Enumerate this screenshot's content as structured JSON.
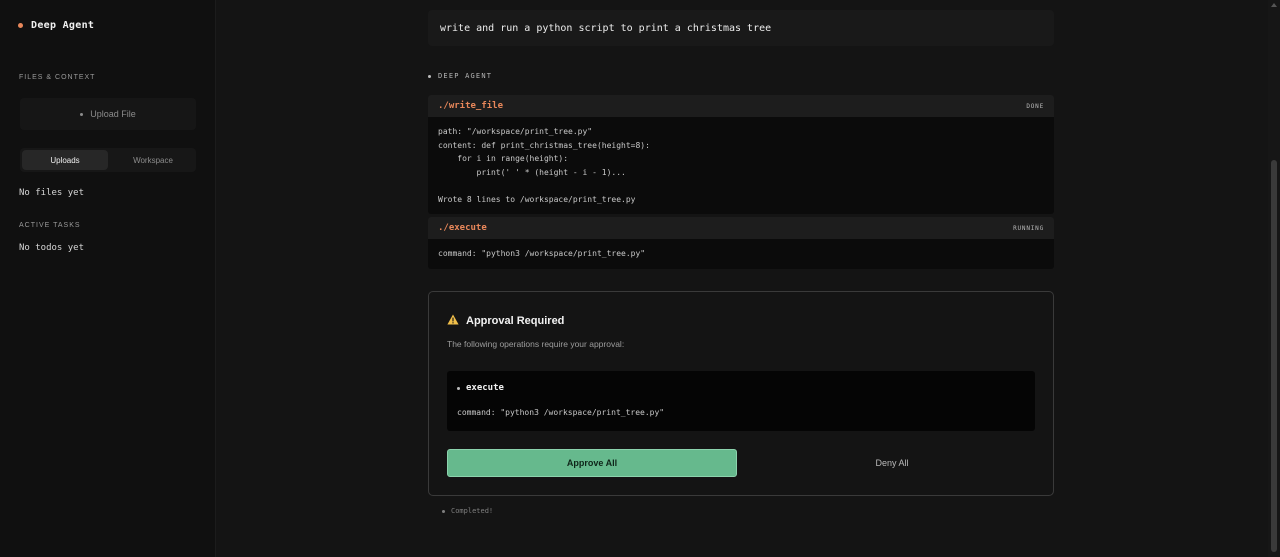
{
  "sidebar": {
    "brand": "Deep Agent",
    "files_label": "FILES & CONTEXT",
    "upload_label": "Upload File",
    "tabs": [
      {
        "label": "Uploads",
        "active": true
      },
      {
        "label": "Workspace",
        "active": false
      }
    ],
    "files_empty": "No files yet",
    "tasks_label": "ACTIVE TASKS",
    "tasks_empty": "No todos yet"
  },
  "chat": {
    "user_prompt": "write and run a python script to print a christmas tree",
    "agent_label": "DEEP AGENT",
    "tools": [
      {
        "name": "./write_file",
        "status": "DONE",
        "body": "path: \"/workspace/print_tree.py\"\ncontent: def print_christmas_tree(height=8):\n    for i in range(height):\n        print(' ' * (height - i - 1)...\n\nWrote 8 lines to /workspace/print_tree.py"
      },
      {
        "name": "./execute",
        "status": "RUNNING",
        "body": "command: \"python3 /workspace/print_tree.py\""
      }
    ],
    "approval": {
      "title": "Approval Required",
      "description": "The following operations require your approval:",
      "operation_name": "execute",
      "operation_command": "command: \"python3 /workspace/print_tree.py\"",
      "approve_label": "Approve All",
      "deny_label": "Deny All"
    },
    "completed_label": "Completed!"
  },
  "colors": {
    "accent": "#e8875a",
    "approve": "#66b98d",
    "background": "#141414"
  },
  "icons": {
    "warning": "warning-icon"
  }
}
